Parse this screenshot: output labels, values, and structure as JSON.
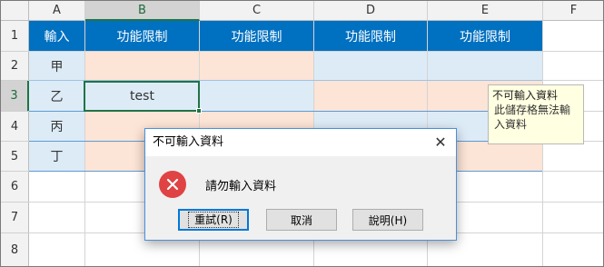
{
  "columns": [
    "A",
    "B",
    "C",
    "D",
    "E",
    "F"
  ],
  "rows": [
    "1",
    "2",
    "3",
    "4",
    "5",
    "6",
    "7",
    "8"
  ],
  "header_row": [
    "輸入",
    "功能限制",
    "功能限制",
    "功能限制",
    "功能限制"
  ],
  "input_cells": {
    "a2": "甲",
    "a3": "乙",
    "a4": "丙",
    "a5": "丁"
  },
  "active_cell": {
    "address": "B3",
    "value": "test"
  },
  "input_message": {
    "title": "不可輸入資料",
    "body": "此儲存格無法輸入資料"
  },
  "dialog": {
    "title": "不可輸入資料",
    "message": "請勿輸入資料",
    "icon": "error-icon",
    "buttons": {
      "retry": "重試(R)",
      "cancel": "取消",
      "help": "說明(H)"
    }
  },
  "colors": {
    "header_blue": "#0070c0",
    "light_blue": "#ddebf7",
    "light_peach": "#fce4d6",
    "selection_green": "#217346",
    "tooltip_bg": "#ffffe1",
    "error_red": "#e04343"
  }
}
